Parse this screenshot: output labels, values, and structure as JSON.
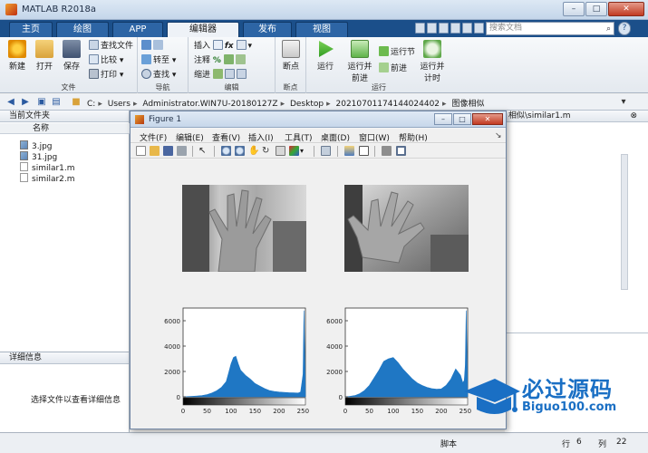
{
  "window": {
    "title": "MATLAB R2018a"
  },
  "tabs": [
    {
      "label": "主页"
    },
    {
      "label": "绘图"
    },
    {
      "label": "APP"
    },
    {
      "label": "编辑器"
    },
    {
      "label": "发布"
    },
    {
      "label": "视图"
    }
  ],
  "search": {
    "placeholder": "搜索文档"
  },
  "ribbon": {
    "file_group": {
      "label": "文件",
      "new": "新建",
      "open": "打开",
      "save": "保存",
      "find_files": "查找文件",
      "compare": "比较",
      "print": "打印"
    },
    "nav_group": {
      "label": "导航",
      "goto": "转至",
      "find": "查找"
    },
    "edit_group": {
      "label": "编辑",
      "insert": "插入",
      "comment": "注释",
      "indent": "缩进",
      "fx": "fx"
    },
    "breakpoint_group": {
      "label": "断点",
      "breakpoints": "断点"
    },
    "run_group": {
      "label": "运行",
      "run": "运行",
      "run_advance": "运行并前进",
      "run_section": "运行节",
      "advance": "前进",
      "run_time": "运行并计时"
    }
  },
  "address": {
    "crumbs": [
      "C:",
      "Users",
      "Administrator.WIN7U-20180127Z",
      "Desktop",
      "20210701174144024402",
      "图像相似"
    ]
  },
  "current_folder": {
    "header": "当前文件夹",
    "column_name": "名称",
    "files": [
      "3.jpg",
      "31.jpg",
      "similar1.m",
      "similar2.m"
    ]
  },
  "details": {
    "header": "详细信息",
    "message": "选择文件以查看详细信息"
  },
  "editor_tab": {
    "label": "相似\\similar1.m"
  },
  "status": {
    "script": "脚本",
    "row_label": "行",
    "row": "6",
    "col_label": "列",
    "col": "22"
  },
  "figure": {
    "title": "Figure 1",
    "menu": [
      "文件(F)",
      "编辑(E)",
      "查看(V)",
      "插入(I)",
      "工具(T)",
      "桌面(D)",
      "窗口(W)",
      "帮助(H)"
    ]
  },
  "watermark": {
    "brand": "必过源码",
    "url": "Biguo100.com"
  },
  "chart_data": [
    {
      "type": "area",
      "title": "",
      "xlabel": "",
      "ylabel": "",
      "xlim": [
        0,
        255
      ],
      "ylim": [
        0,
        7000
      ],
      "x_ticks": [
        0,
        50,
        100,
        150,
        200,
        250
      ],
      "y_ticks": [
        0,
        2000,
        4000,
        6000
      ],
      "color": "#1f77c4",
      "series": [
        {
          "x": [
            0,
            10,
            20,
            30,
            40,
            50,
            60,
            70,
            80,
            90,
            95,
            100,
            105,
            110,
            115,
            120,
            130,
            140,
            150,
            160,
            170,
            180,
            190,
            200,
            210,
            220,
            230,
            240,
            245,
            248,
            250,
            252,
            255
          ],
          "values": [
            0,
            20,
            40,
            70,
            110,
            180,
            300,
            480,
            750,
            1200,
            1900,
            2600,
            3100,
            3200,
            2600,
            2100,
            1700,
            1400,
            1050,
            850,
            650,
            500,
            420,
            380,
            350,
            330,
            320,
            300,
            380,
            1200,
            1800,
            6800,
            300
          ]
        }
      ]
    },
    {
      "type": "area",
      "title": "",
      "xlabel": "",
      "ylabel": "",
      "xlim": [
        0,
        255
      ],
      "ylim": [
        0,
        7000
      ],
      "x_ticks": [
        0,
        50,
        100,
        150,
        200,
        250
      ],
      "y_ticks": [
        0,
        2000,
        4000,
        6000
      ],
      "color": "#1f77c4",
      "series": [
        {
          "x": [
            0,
            10,
            20,
            30,
            40,
            50,
            60,
            70,
            80,
            90,
            100,
            110,
            120,
            130,
            140,
            150,
            160,
            170,
            180,
            190,
            200,
            210,
            220,
            230,
            240,
            245,
            248,
            250,
            252,
            255
          ],
          "values": [
            0,
            40,
            100,
            250,
            500,
            900,
            1500,
            2100,
            2800,
            3000,
            3100,
            2700,
            2200,
            1800,
            1400,
            1100,
            900,
            750,
            650,
            600,
            620,
            900,
            1400,
            2200,
            1700,
            1100,
            1300,
            2500,
            6800,
            300
          ]
        }
      ]
    }
  ]
}
